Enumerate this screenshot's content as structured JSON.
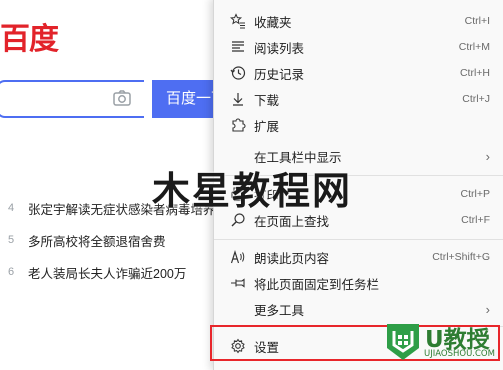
{
  "page": {
    "logo": "百度",
    "search_button": "百度一下",
    "hot_list": [
      {
        "rank": "4",
        "text": "张定宇解读无症状感染者病毒培养"
      },
      {
        "rank": "5",
        "text": "多所高校将全额退宿舍费"
      },
      {
        "rank": "6",
        "text": "老人装局长夫人诈骗近200万"
      }
    ]
  },
  "menu": {
    "items": [
      {
        "label": "收藏夹",
        "shortcut": "Ctrl+I",
        "icon": "favorites-icon"
      },
      {
        "label": "阅读列表",
        "shortcut": "Ctrl+M",
        "icon": "reading-list-icon"
      },
      {
        "label": "历史记录",
        "shortcut": "Ctrl+H",
        "icon": "history-icon"
      },
      {
        "label": "下载",
        "shortcut": "Ctrl+J",
        "icon": "download-icon"
      },
      {
        "label": "扩展",
        "shortcut": "",
        "icon": "extensions-icon"
      },
      {
        "label": "在工具栏中显示",
        "shortcut": "",
        "icon": "",
        "submenu": true
      },
      {
        "label": "打印",
        "shortcut": "Ctrl+P",
        "icon": "print-icon"
      },
      {
        "label": "在页面上查找",
        "shortcut": "Ctrl+F",
        "icon": "find-icon"
      },
      {
        "label": "朗读此页内容",
        "shortcut": "Ctrl+Shift+G",
        "icon": "read-aloud-icon"
      },
      {
        "label": "将此页面固定到任务栏",
        "shortcut": "",
        "icon": "pin-icon"
      },
      {
        "label": "更多工具",
        "shortcut": "",
        "icon": "",
        "submenu": true
      },
      {
        "label": "设置",
        "shortcut": "",
        "icon": "settings-icon"
      }
    ]
  },
  "watermark": {
    "main": "木星教程网",
    "logo_text": "U教授",
    "logo_url": "UJIAOSHOU.COM"
  },
  "colors": {
    "baidu_red": "#e2232a",
    "baidu_blue": "#4e6ef2",
    "highlight_red": "#e8262b",
    "watermark_green": "#2e7d32"
  }
}
